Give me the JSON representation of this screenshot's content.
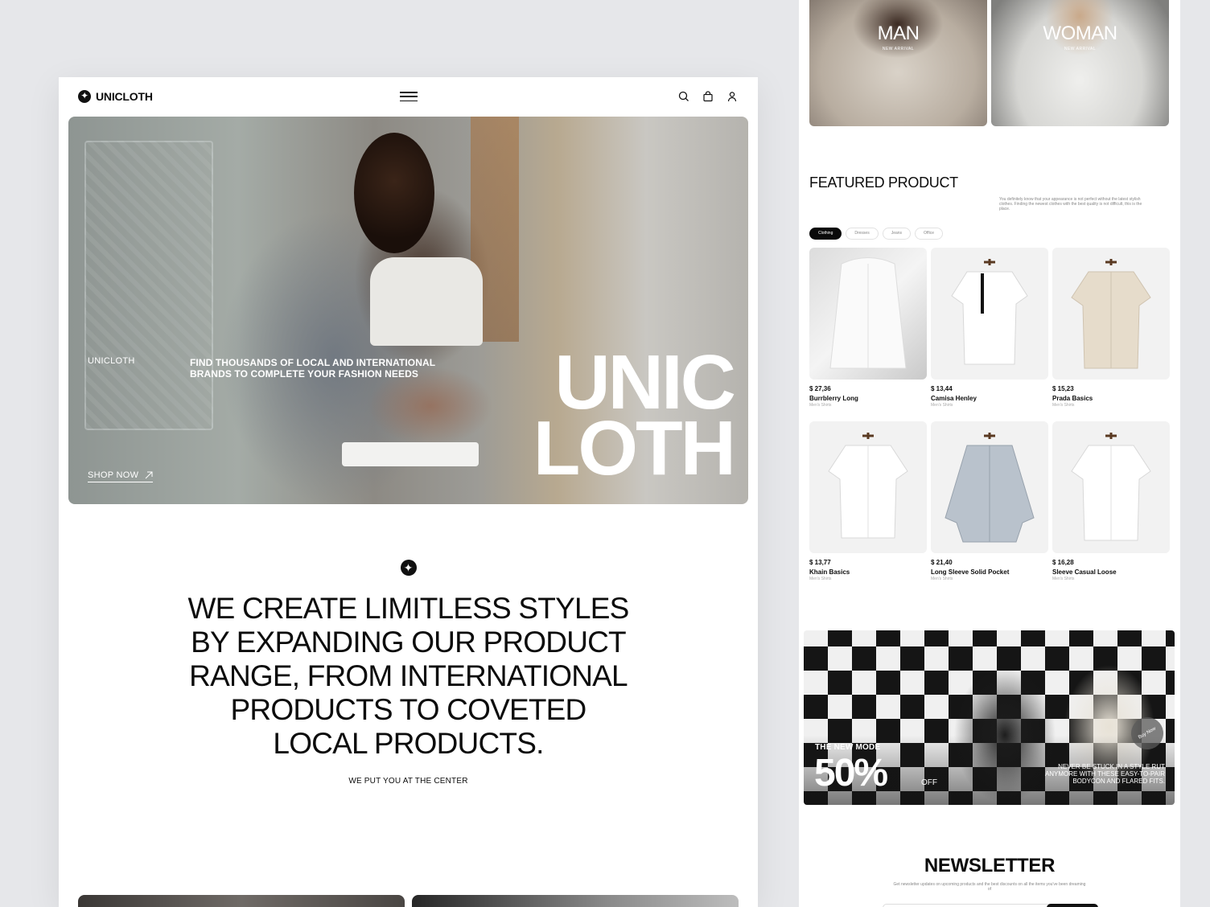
{
  "left": {
    "brand": "UNICLOTH",
    "hero": {
      "brand_label": "UNICLOTH",
      "tagline": "FIND THOUSANDS OF LOCAL AND INTERNATIONAL BRANDS TO COMPLETE YOUR FASHION NEEDS",
      "shop_now": "SHOP NOW",
      "big_line1": "UNIC",
      "big_line2": "LOTH"
    },
    "mission": {
      "title": "WE CREATE LIMITLESS STYLES BY EXPANDING OUR PRODUCT RANGE, FROM INTERNATIONAL PRODUCTS TO COVETED LOCAL PRODUCTS.",
      "subtitle": "WE PUT YOU AT THE CENTER"
    }
  },
  "right": {
    "categories": [
      {
        "title": "MAN",
        "subtitle": "NEW ARRIVAL"
      },
      {
        "title": "WOMAN",
        "subtitle": "NEW ARRIVAL"
      }
    ],
    "featured": {
      "title": "FEATURED PRODUCT",
      "description": "You definitely know that your appearance is not perfect without the latest stylish clothes. Finding the newest clothes with the best quality is not difficult, this is the place.",
      "filters": [
        "Clothing",
        "Dresses",
        "Jeans",
        "Office"
      ],
      "products": [
        {
          "price": "$ 27,36",
          "name": "Burrblerry Long",
          "category": "Men's Shirts"
        },
        {
          "price": "$ 13,44",
          "name": "Camisa Henley",
          "category": "Men's Shirts"
        },
        {
          "price": "$ 15,23",
          "name": "Prada Basics",
          "category": "Men's Shirts"
        },
        {
          "price": "$ 13,77",
          "name": "Khain Basics",
          "category": "Men's Shirts"
        },
        {
          "price": "$ 21,40",
          "name": "Long Sleeve Solid Pocket",
          "category": "Men's Shirts"
        },
        {
          "price": "$ 16,28",
          "name": "Sleeve Casual Loose",
          "category": "Men's Shirts"
        }
      ]
    },
    "promo": {
      "label": "THE NEW MODE",
      "percent": "50%",
      "off": "OFF",
      "note": "NEVER BE STUCK IN A STYLE RUT ANYMORE WITH THESE EASY-TO-PAIR BODYCON AND FLARED FITS.",
      "buy": "Buy Now"
    },
    "newsletter": {
      "title": "NEWSLETTER",
      "description": "Get newsletter updates on upcoming products and the best discounts on all the items you've been dreaming of"
    }
  },
  "icons": [
    "logo-icon",
    "menu-icon",
    "search-icon",
    "bag-icon",
    "user-icon",
    "arrow-up-right-icon"
  ]
}
